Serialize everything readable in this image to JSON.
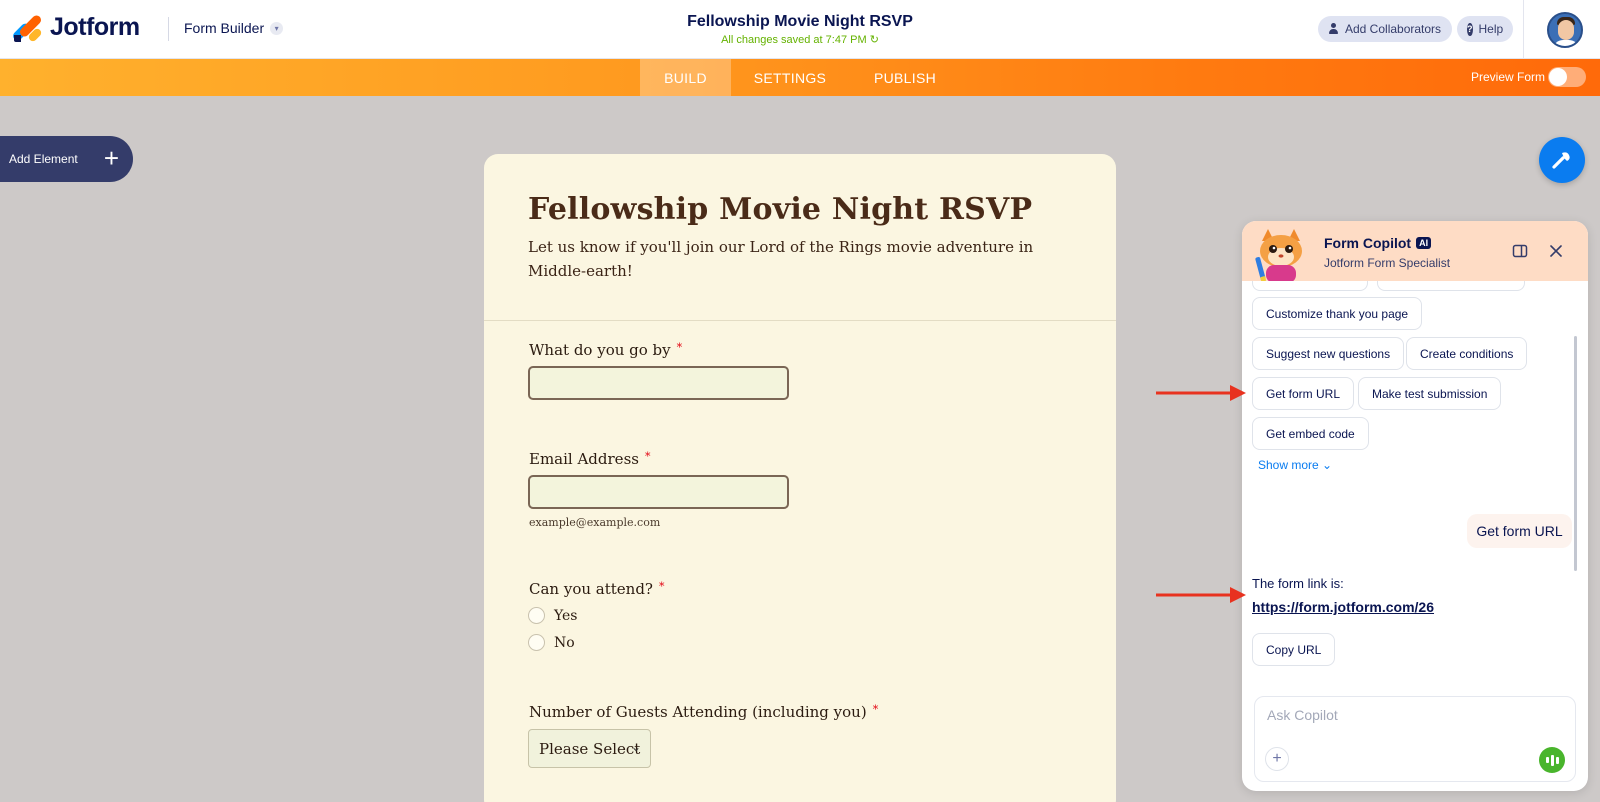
{
  "header": {
    "logo_text": "Jotform",
    "builder_menu": "Form Builder",
    "form_title": "Fellowship Movie Night RSVP",
    "save_status": "All changes saved at 7:47 PM",
    "add_collaborators": "Add Collaborators",
    "help": "Help"
  },
  "nav": {
    "tabs": [
      {
        "label": "BUILD",
        "active": true
      },
      {
        "label": "SETTINGS",
        "active": false
      },
      {
        "label": "PUBLISH",
        "active": false
      }
    ],
    "preview_label": "Preview Form",
    "preview_on": false
  },
  "sidebar": {
    "add_element": "Add Element"
  },
  "form": {
    "heading": "Fellowship Movie Night RSVP",
    "description": "Let us know if you'll join our Lord of the Rings movie adventure in Middle-earth!",
    "fields": [
      {
        "label": "What do you go by",
        "required": true,
        "type": "text",
        "value": ""
      },
      {
        "label": "Email Address",
        "required": true,
        "type": "email",
        "value": "",
        "hint": "example@example.com"
      },
      {
        "label": "Can you attend?",
        "required": true,
        "type": "radio",
        "options": [
          "Yes",
          "No"
        ]
      },
      {
        "label": "Number of Guests Attending (including you)",
        "required": true,
        "type": "select",
        "value": "Please Select"
      }
    ],
    "required_mark": "*"
  },
  "copilot": {
    "title": "Form Copilot",
    "badge": "AI",
    "subtitle": "Jotform Form Specialist",
    "suggestions": [
      "Customize thank you page",
      "Suggest new questions",
      "Create conditions",
      "Get form URL",
      "Make test submission",
      "Get embed code"
    ],
    "show_more": "Show more",
    "user_message": "Get form URL",
    "bot_message": "The form link is:",
    "bot_link": "https://form.jotform.com/26",
    "copy_url": "Copy URL",
    "input_placeholder": "Ask Copilot"
  },
  "colors": {
    "nav_gradient_start": "#ffb12d",
    "nav_gradient_end": "#ff6a0a",
    "brand_navy": "#0a1551",
    "form_background": "#fbf6e1",
    "copilot_header": "#fedcc5",
    "annotation_arrow": "#e8321f",
    "accent_blue": "#0a7cf0",
    "saved_green": "#64b200"
  }
}
